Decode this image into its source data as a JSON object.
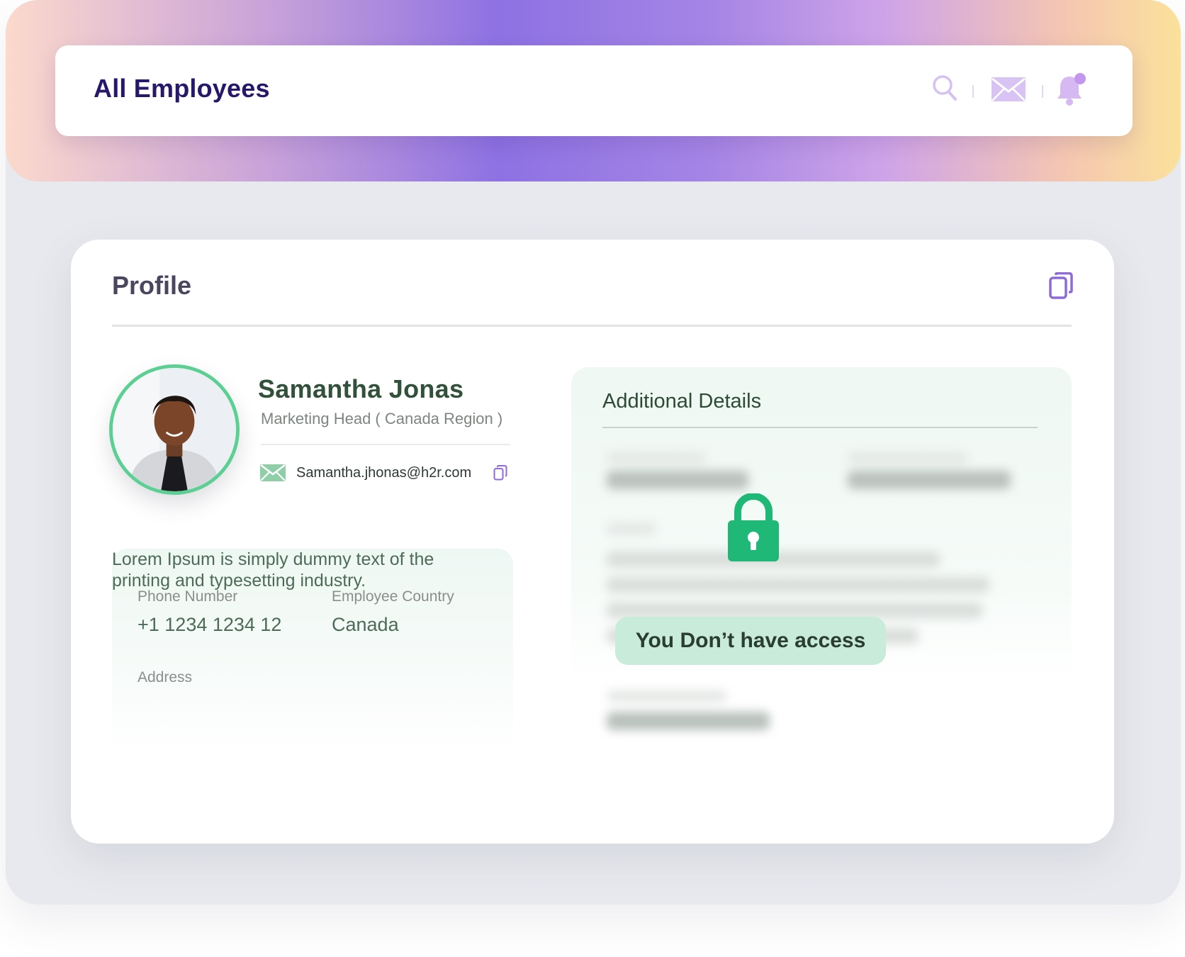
{
  "header": {
    "title": "All Employees",
    "icons": [
      "search-icon",
      "mail-icon",
      "bell-icon"
    ]
  },
  "profile": {
    "title": "Profile",
    "action_icon": "copy-icon",
    "name": "Samantha Jonas",
    "role": "Marketing Head ( Canada Region )",
    "email": "Samantha.jhonas@h2r.com",
    "phone_label": "Phone Number",
    "phone": "+1 1234 1234 12",
    "country_label": "Employee Country",
    "country": "Canada",
    "address_label": "Address",
    "address": "Lorem Ipsum is simply dummy text of the printing and typesetting industry."
  },
  "additional": {
    "title": "Additional Details",
    "locked_message": "You Don’t have access"
  },
  "colors": {
    "brand_purple": "#27186c",
    "accent_green": "#1fb877",
    "ring_green": "#5ccf92",
    "icon_lavender": "#c9aef0"
  }
}
